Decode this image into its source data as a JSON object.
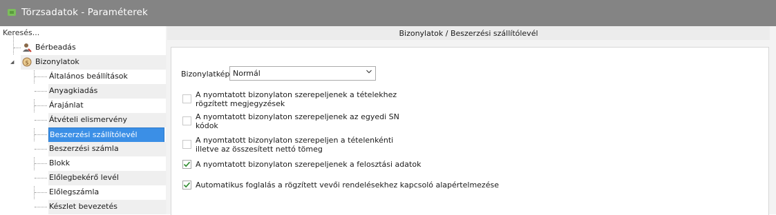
{
  "window": {
    "title": "Törzsadatok - Paraméterek"
  },
  "sidebar": {
    "search_placeholder": "Keresés...",
    "items": [
      {
        "label": "Bérbeadás"
      },
      {
        "label": "Bizonylatok"
      }
    ],
    "children": [
      {
        "label": "Általános beállítások"
      },
      {
        "label": "Anyagkiadás"
      },
      {
        "label": "Árajánlat"
      },
      {
        "label": "Átvételi elismervény"
      },
      {
        "label": "Beszerzési szállítólevél"
      },
      {
        "label": "Beszerzési számla"
      },
      {
        "label": "Blokk"
      },
      {
        "label": "Előlegbekérő levél"
      },
      {
        "label": "Előlegszámla"
      },
      {
        "label": "Készlet bevezetés"
      }
    ]
  },
  "content": {
    "breadcrumb": "Bizonylatok / Beszerzési szállítólevél",
    "bizonylatkep_label": "Bizonylatkép:",
    "bizonylatkep_value": "Normál",
    "options": [
      {
        "line1": "A nyomtatott bizonylaton szerepeljenek a tételekhez",
        "line2": "rögzített megjegyzések",
        "checked": false
      },
      {
        "line1": "A nyomtatott bizonylaton szerepeljenek az egyedi SN",
        "line2": "kódok",
        "checked": false
      },
      {
        "line1": "A nyomtatott bizonylaton szerepeljen a tételenkénti",
        "line2": "illetve az összesített nettó tömeg",
        "checked": false
      },
      {
        "line1": "A nyomtatott bizonylaton szerepeljenek a felosztási adatok",
        "line2": "",
        "checked": true
      },
      {
        "line1": "Automatikus foglalás a rögzített vevői rendelésekhez kapcsoló alapértelmezése",
        "line2": "",
        "checked": true
      }
    ]
  },
  "colors": {
    "titlebar": "#848484",
    "selection": "#3b8fe6"
  }
}
